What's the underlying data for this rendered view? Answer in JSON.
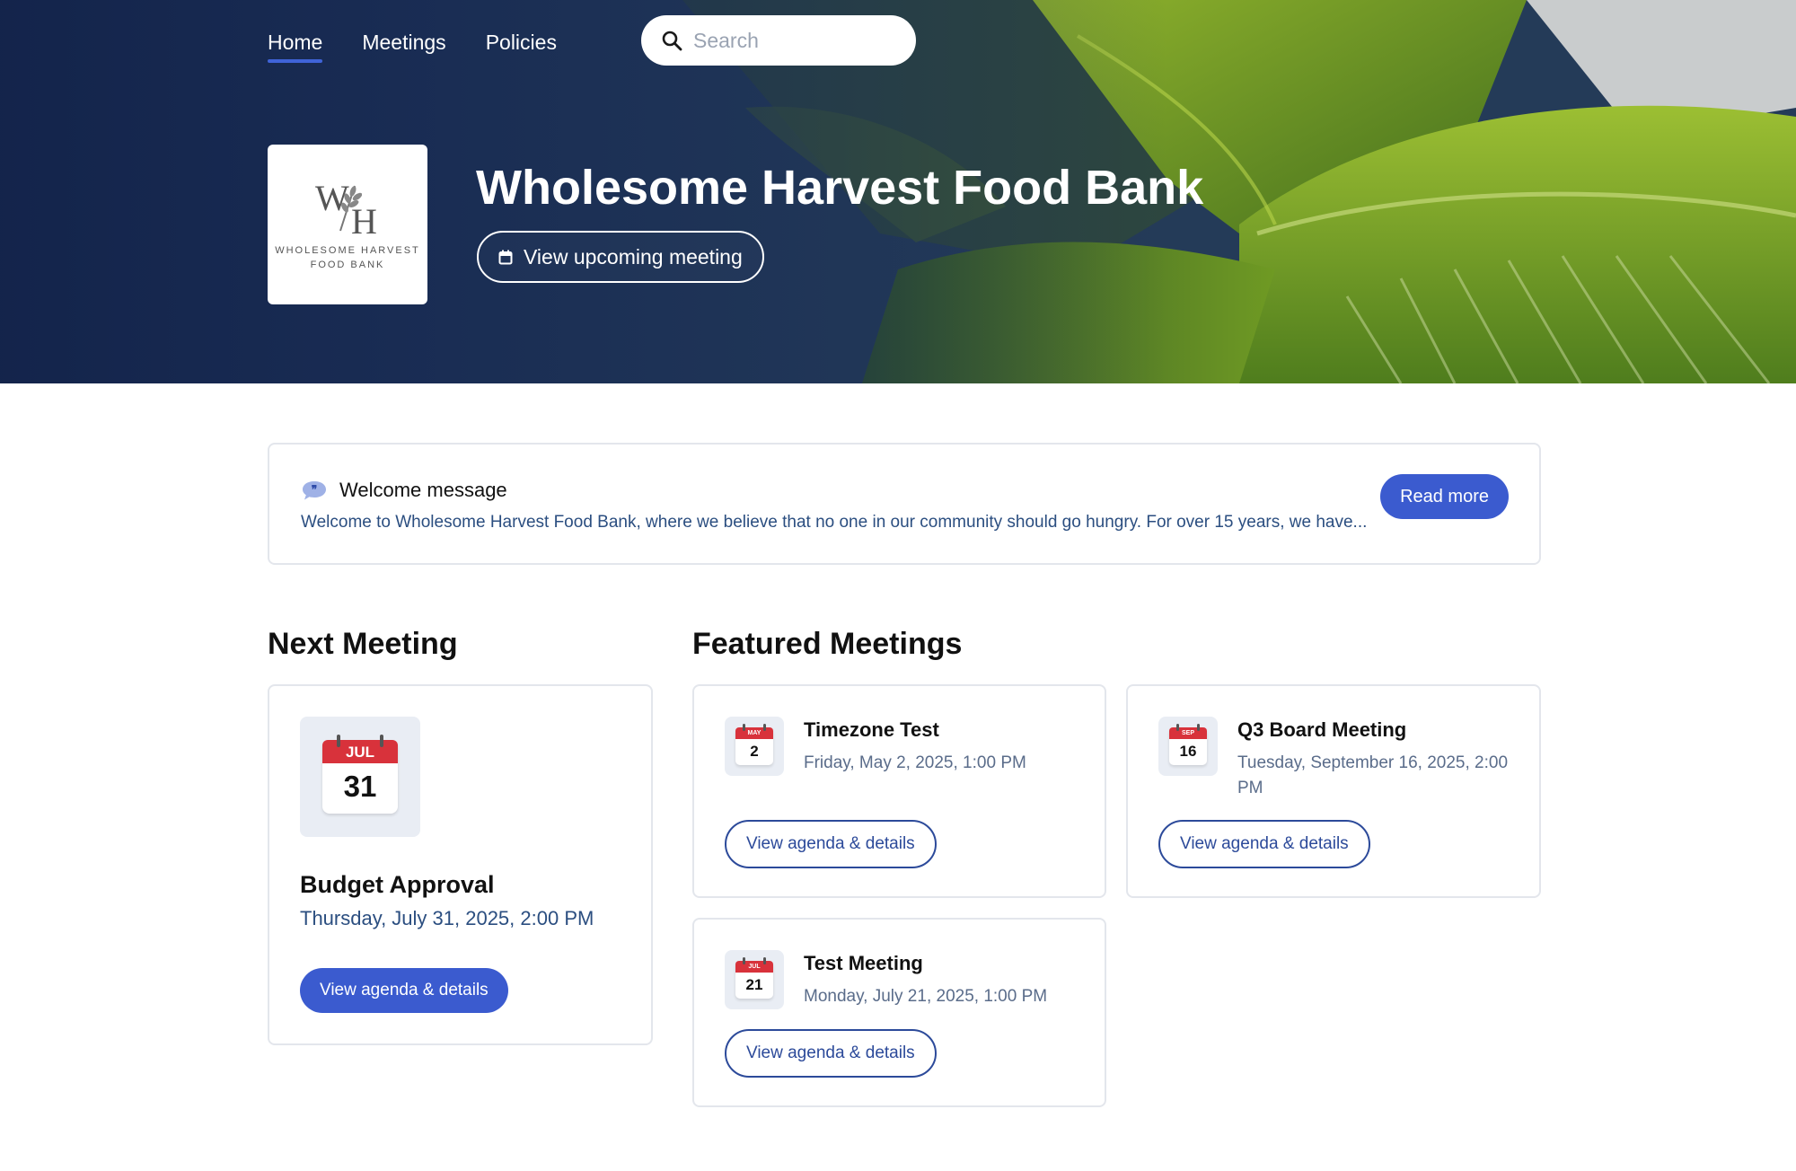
{
  "nav": {
    "items": [
      {
        "label": "Home",
        "active": true
      },
      {
        "label": "Meetings",
        "active": false
      },
      {
        "label": "Policies",
        "active": false
      }
    ]
  },
  "search": {
    "placeholder": "Search"
  },
  "logo": {
    "monogram_w": "W",
    "monogram_h": "H",
    "line1": "WHOLESOME HARVEST",
    "line2": "FOOD BANK"
  },
  "hero": {
    "title": "Wholesome Harvest Food Bank",
    "upcoming_button": "View upcoming meeting"
  },
  "welcome": {
    "title": "Welcome message",
    "body": "Welcome to Wholesome Harvest Food Bank, where we believe that no one in our community should go hungry. For over 15 years, we have...",
    "read_more": "Read more"
  },
  "next_meeting": {
    "section_title": "Next Meeting",
    "month": "JUL",
    "day": "31",
    "name": "Budget Approval",
    "date": "Thursday, July 31, 2025, 2:00 PM",
    "button": "View agenda & details"
  },
  "featured": {
    "section_title": "Featured Meetings",
    "meetings": [
      {
        "month": "MAY",
        "day": "2",
        "name": "Timezone Test",
        "date": "Friday, May 2, 2025, 1:00 PM",
        "button": "View agenda & details"
      },
      {
        "month": "SEP",
        "day": "16",
        "name": "Q3 Board Meeting",
        "date": "Tuesday, September 16, 2025, 2:00 PM",
        "button": "View agenda & details"
      },
      {
        "month": "JUL",
        "day": "21",
        "name": "Test Meeting",
        "date": "Monday, July 21, 2025, 1:00 PM",
        "button": "View agenda & details"
      }
    ]
  },
  "colors": {
    "accent": "#3b5bcf",
    "calendar_red": "#d8323b",
    "date_text": "#2b4e80",
    "hero_navy": "#1c2f59",
    "leaf_green": "#4c7e1e"
  },
  "icons": [
    "search-icon",
    "calendar-icon",
    "quote-icon",
    "calendar-date-icon"
  ]
}
